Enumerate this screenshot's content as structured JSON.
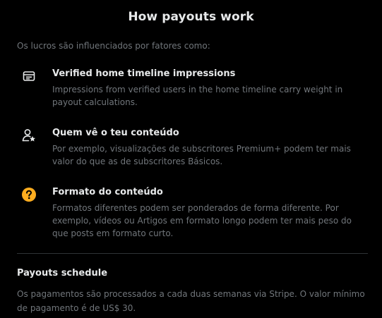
{
  "modal": {
    "title": "How payouts work",
    "intro": "Os lucros são influenciados por fatores como:"
  },
  "factors": [
    {
      "icon": "timeline-card-icon",
      "title": "Verified home timeline impressions",
      "description": "Impressions from verified users in the home timeline carry weight in payout calculations."
    },
    {
      "icon": "user-star-icon",
      "title": "Quem vê o teu conteúdo",
      "description": "Por exemplo, visualizações de subscritores Premium+ podem ter mais valor do que as de subscritores Básicos."
    },
    {
      "icon": "question-circle-icon",
      "title": "Formato do conteúdo",
      "description": "Formatos diferentes podem ser ponderados de forma diferente. Por exemplo, vídeos ou Artigos em formato longo podem ter mais peso do que posts em formato curto."
    }
  ],
  "schedule": {
    "title": "Payouts schedule",
    "description": "Os pagamentos são processados a cada duas semanas via Stripe. O valor mínimo de pagamento é de US$ 30."
  },
  "colors": {
    "background": "#000000",
    "primary_text": "#e7e9ea",
    "secondary_text": "#71767b",
    "divider": "#2f3336",
    "question_icon": "#ffad1f"
  }
}
